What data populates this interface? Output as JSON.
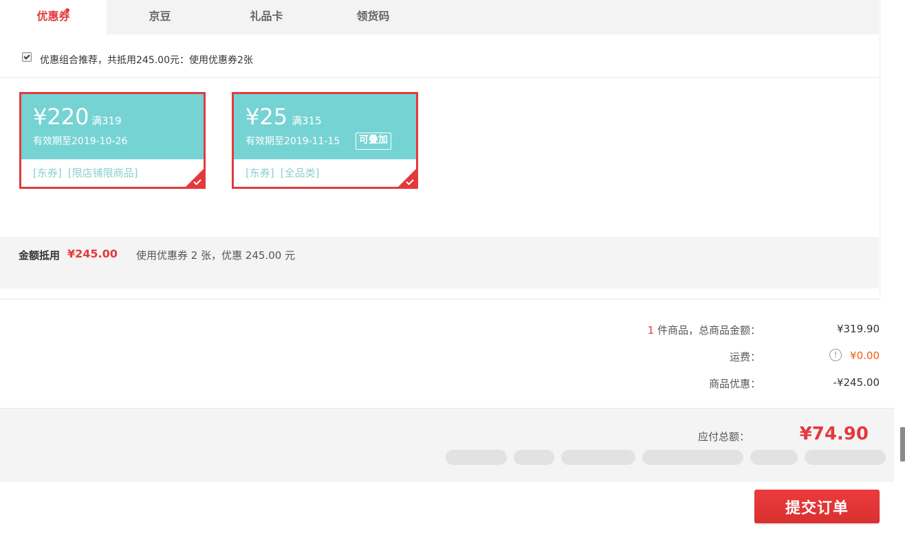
{
  "tabs": [
    {
      "label": "优惠券",
      "active": true,
      "badge": true
    },
    {
      "label": "京豆",
      "active": false
    },
    {
      "label": "礼品卡",
      "active": false
    },
    {
      "label": "领货码",
      "active": false
    }
  ],
  "combo": {
    "checked": true,
    "text": "优惠组合推荐，共抵用245.00元：使用优惠券2张"
  },
  "coupons": [
    {
      "amount": "¥220",
      "condition": "满319",
      "validity": "有效期至2019-10-26",
      "tag1": "[东券]",
      "tag2": "[限店铺限商品]",
      "selected": true
    },
    {
      "amount": "¥25",
      "condition": "满315",
      "validity": "有效期至2019-11-15",
      "stackable": "可叠加",
      "tag1": "[东券]",
      "tag2": "[全品类]",
      "selected": true
    }
  ],
  "amount_bar": {
    "label": "金额抵用",
    "value": "¥245.00",
    "desc": "使用优惠券 2 张，优惠 245.00 元"
  },
  "summary": {
    "count": "1",
    "count_label": " 件商品，总商品金额：",
    "goods_total": "¥319.90",
    "shipping_label": "运费：",
    "shipping_icon": "!",
    "shipping_value": "¥0.00",
    "discount_label": "商品优惠：",
    "discount_value": "-¥245.00"
  },
  "total": {
    "label": "应付总额：",
    "value": "¥74.90"
  },
  "submit_label": "提交订单",
  "colors": {
    "brand_red": "#e4393c",
    "coupon_teal": "#76d3d4",
    "orange": "#f35b0a"
  }
}
